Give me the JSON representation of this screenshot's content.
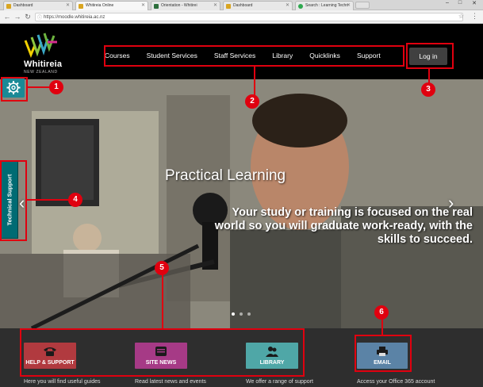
{
  "browser": {
    "tabs": [
      {
        "label": "Dashboard"
      },
      {
        "label": "Whitireia Online"
      },
      {
        "label": "Orientation - Whitirei"
      },
      {
        "label": "Dashboard"
      },
      {
        "label": "Search : Learning Techn"
      }
    ],
    "url": "https://moodle.whitireia.ac.nz"
  },
  "site": {
    "logo_name": "Whitireia",
    "logo_sub": "NEW ZEALAND",
    "nav": [
      "Courses",
      "Student Services",
      "Staff Services",
      "Library",
      "Quicklinks",
      "Support"
    ],
    "login_label": "Log in"
  },
  "hero": {
    "title": "Practical Learning",
    "subtitle": "Your study or training is focused on the real world so you will graduate work-ready, with the skills to succeed."
  },
  "tech_support": {
    "label": "Technical Support"
  },
  "tiles": [
    {
      "label": "HELP & SUPPORT",
      "color": "#b13a3f",
      "icon": "telephone-icon",
      "desc": "Here you will find useful guides"
    },
    {
      "label": "SITE NEWS",
      "color": "#a63a86",
      "icon": "news-icon",
      "desc": "Read latest news and events"
    },
    {
      "label": "LIBRARY",
      "color": "#4fa7a7",
      "icon": "people-icon",
      "desc": "We offer a range of support"
    },
    {
      "label": "EMAIL",
      "color": "#5b83a6",
      "icon": "printer-email-icon",
      "desc": "Access your Office 365 account"
    }
  ],
  "annotations": [
    "1",
    "2",
    "3",
    "4",
    "5",
    "6"
  ],
  "colors": {
    "annotation": "#e0000f",
    "header_bg": "#000000",
    "gear_bg": "#1a8a96",
    "tech_tab": "#006b73"
  }
}
